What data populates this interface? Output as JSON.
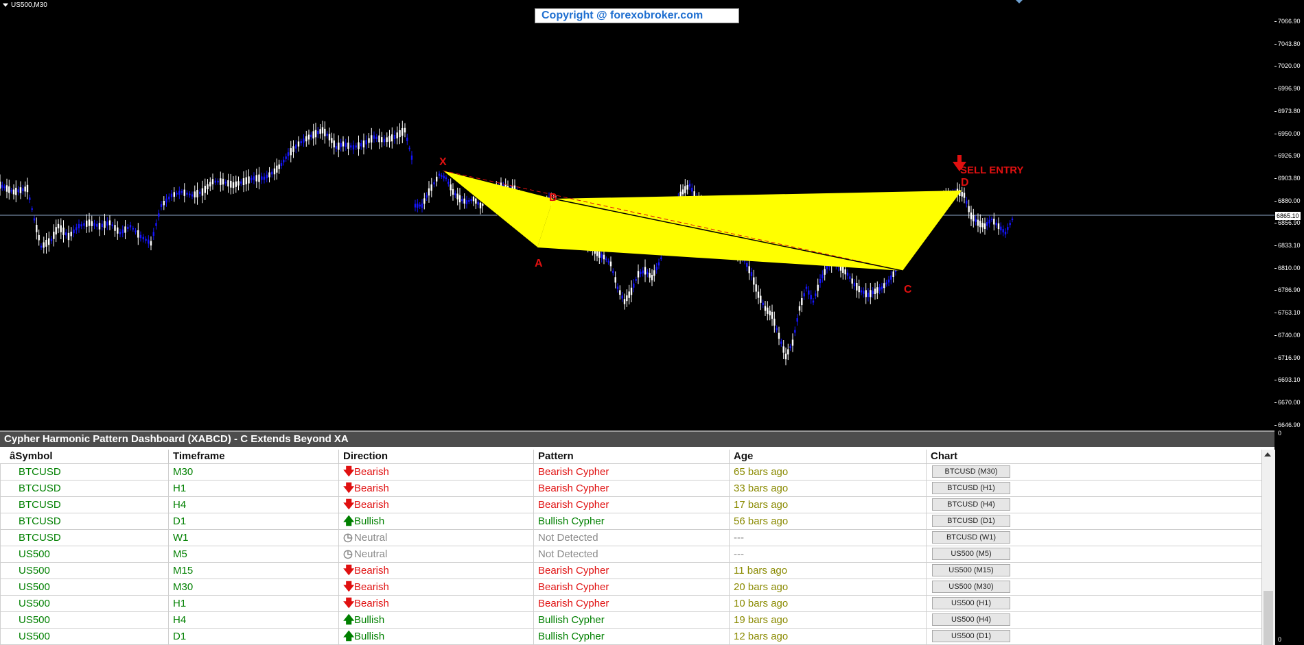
{
  "chart": {
    "symbol_label": "US500,M30",
    "copyright": "Copyright @ forexobroker.com",
    "price_ticks": [
      "7066.90",
      "7043.80",
      "7020.00",
      "6996.90",
      "6973.80",
      "6950.00",
      "6926.90",
      "6903.80",
      "6880.00",
      "6856.90",
      "6833.10",
      "6810.00",
      "6786.90",
      "6763.10",
      "6740.00",
      "6716.90",
      "6693.10",
      "6670.00",
      "6646.90"
    ],
    "current_price": "6865.10",
    "pattern_points": {
      "x": "X",
      "a": "A",
      "b": "B",
      "c": "C",
      "d": "D"
    },
    "signal_label": "SELL ENTRY",
    "colors": {
      "pattern_fill": "#ffff00",
      "label_red": "#e01010",
      "candle_up": "#1010ff",
      "candle_down": "#ffffff"
    }
  },
  "panel": {
    "title": "Cypher Harmonic Pattern Dashboard (XABCD) - C Extends Beyond XA",
    "headers": {
      "symbol": "âSymbol",
      "timeframe": "Timeframe",
      "direction": "Direction",
      "pattern": "Pattern",
      "age": "Age",
      "chart": "Chart"
    },
    "rows": [
      {
        "symbol": "BTCUSD",
        "tf": "M30",
        "direction": "Bearish",
        "dir_icon": "arrow-down",
        "pattern": "Bearish Cypher",
        "age": "65 bars ago",
        "chart": "BTCUSD (M30)"
      },
      {
        "symbol": "BTCUSD",
        "tf": "H1",
        "direction": "Bearish",
        "dir_icon": "arrow-down",
        "pattern": "Bearish Cypher",
        "age": "33 bars ago",
        "chart": "BTCUSD (H1)"
      },
      {
        "symbol": "BTCUSD",
        "tf": "H4",
        "direction": "Bearish",
        "dir_icon": "arrow-down",
        "pattern": "Bearish Cypher",
        "age": "17 bars ago",
        "chart": "BTCUSD (H4)"
      },
      {
        "symbol": "BTCUSD",
        "tf": "D1",
        "direction": "Bullish",
        "dir_icon": "arrow-up",
        "pattern": "Bullish Cypher",
        "age": "56 bars ago",
        "chart": "BTCUSD (D1)"
      },
      {
        "symbol": "BTCUSD",
        "tf": "W1",
        "direction": "Neutral",
        "dir_icon": "clock",
        "pattern": "Not Detected",
        "age": "---",
        "chart": "BTCUSD (W1)"
      },
      {
        "symbol": "US500",
        "tf": "M5",
        "direction": "Neutral",
        "dir_icon": "clock",
        "pattern": "Not Detected",
        "age": "---",
        "chart": "US500 (M5)"
      },
      {
        "symbol": "US500",
        "tf": "M15",
        "direction": "Bearish",
        "dir_icon": "arrow-down",
        "pattern": "Bearish Cypher",
        "age": "11 bars ago",
        "chart": "US500 (M15)"
      },
      {
        "symbol": "US500",
        "tf": "M30",
        "direction": "Bearish",
        "dir_icon": "arrow-down",
        "pattern": "Bearish Cypher",
        "age": "20 bars ago",
        "chart": "US500 (M30)"
      },
      {
        "symbol": "US500",
        "tf": "H1",
        "direction": "Bearish",
        "dir_icon": "arrow-down",
        "pattern": "Bearish Cypher",
        "age": "10 bars ago",
        "chart": "US500 (H1)"
      },
      {
        "symbol": "US500",
        "tf": "H4",
        "direction": "Bullish",
        "dir_icon": "arrow-up",
        "pattern": "Bullish Cypher",
        "age": "19 bars ago",
        "chart": "US500 (H4)"
      },
      {
        "symbol": "US500",
        "tf": "D1",
        "direction": "Bullish",
        "dir_icon": "arrow-up",
        "pattern": "Bullish Cypher",
        "age": "12 bars ago",
        "chart": "US500 (D1)"
      }
    ]
  },
  "axis_zero": "0"
}
